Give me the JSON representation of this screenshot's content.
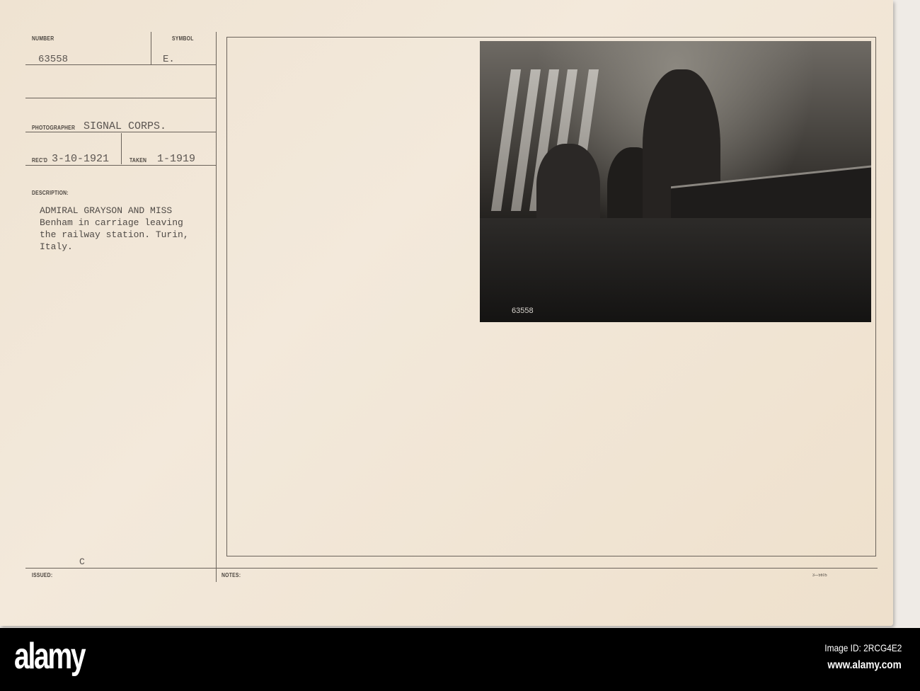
{
  "card": {
    "number_label": "NUMBER",
    "number": "63558",
    "symbol_label": "SYMBOL",
    "symbol": "E.",
    "photographer_label": "PHOTOGRAPHER",
    "photographer": "SIGNAL CORPS.",
    "recd_label": "REC'D",
    "recd": "3-10-1921",
    "taken_label": "TAKEN",
    "taken": "1-1919",
    "description_label": "DESCRIPTION:",
    "description": "ADMIRAL GRAYSON AND MISS\nBenham in carriage leaving\nthe railway station. Turin,\nItaly.",
    "issued_label": "ISSUED:",
    "issued": "C",
    "notes_label": "NOTES:",
    "form_number": "3—5605"
  },
  "photo": {
    "negative_number": "63558"
  },
  "footer": {
    "logo": "alamy",
    "image_id": "Image ID: 2RCG4E2",
    "url": "www.alamy.com"
  }
}
